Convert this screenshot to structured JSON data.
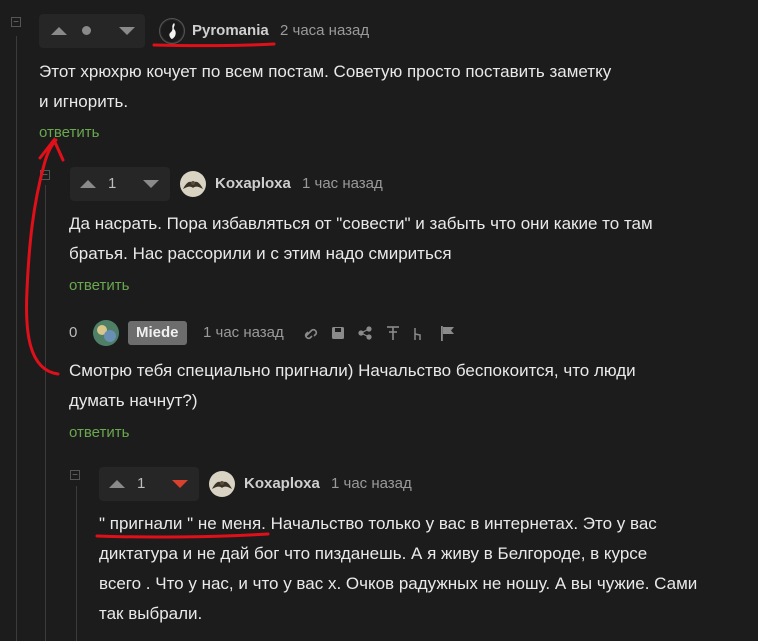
{
  "comments": [
    {
      "collapse": "−",
      "score": "",
      "author": "Pyromania",
      "time": "2 часа назад",
      "text_lines": [
        "Этот хрюхрю кочует по всем постам. Советую просто поставить заметку",
        "и игнорить."
      ],
      "reply": "ответить"
    },
    {
      "collapse": "−",
      "score": "1",
      "author": "Koxaploxa",
      "time": "1 час назад",
      "text_lines": [
        "Да насрать. Пора избавляться от \"совести\" и забыть что они какие то там",
        "братья. Нас рассорили и с этим надо смириться"
      ],
      "reply": "ответить"
    },
    {
      "score": "0",
      "author": "Miede",
      "time": "1 час назад",
      "text_lines": [
        "Смотрю тебя специально пригнали) Начальство беспокоится, что люди",
        "думать начнут?)"
      ],
      "reply": "ответить"
    },
    {
      "collapse": "−",
      "score": "1",
      "author": "Koxaploxa",
      "time": "1 час назад",
      "text_lines": [
        "\" пригнали \" не меня. Начальство только у вас в интернетах. Это у вас",
        "диктатура и не дай бог что пизданешь. А я живу в Белгороде, в курсе",
        "всего . Что у нас, и что у вас х. Очков радужных не ношу. А вы чужие. Сами",
        "так выбрали."
      ]
    }
  ],
  "icons": {
    "upvote": "triangle-up",
    "downvote": "triangle-down",
    "link": "link-icon",
    "save": "save-icon",
    "share": "share-icon",
    "pin": "pin-icon",
    "hand": "hand-icon",
    "flag": "flag-icon"
  },
  "colors": {
    "background": "#1c1c1c",
    "reply_link": "#6aa84f",
    "downvote_active": "#d9412f",
    "annotation": "#e0101a"
  }
}
